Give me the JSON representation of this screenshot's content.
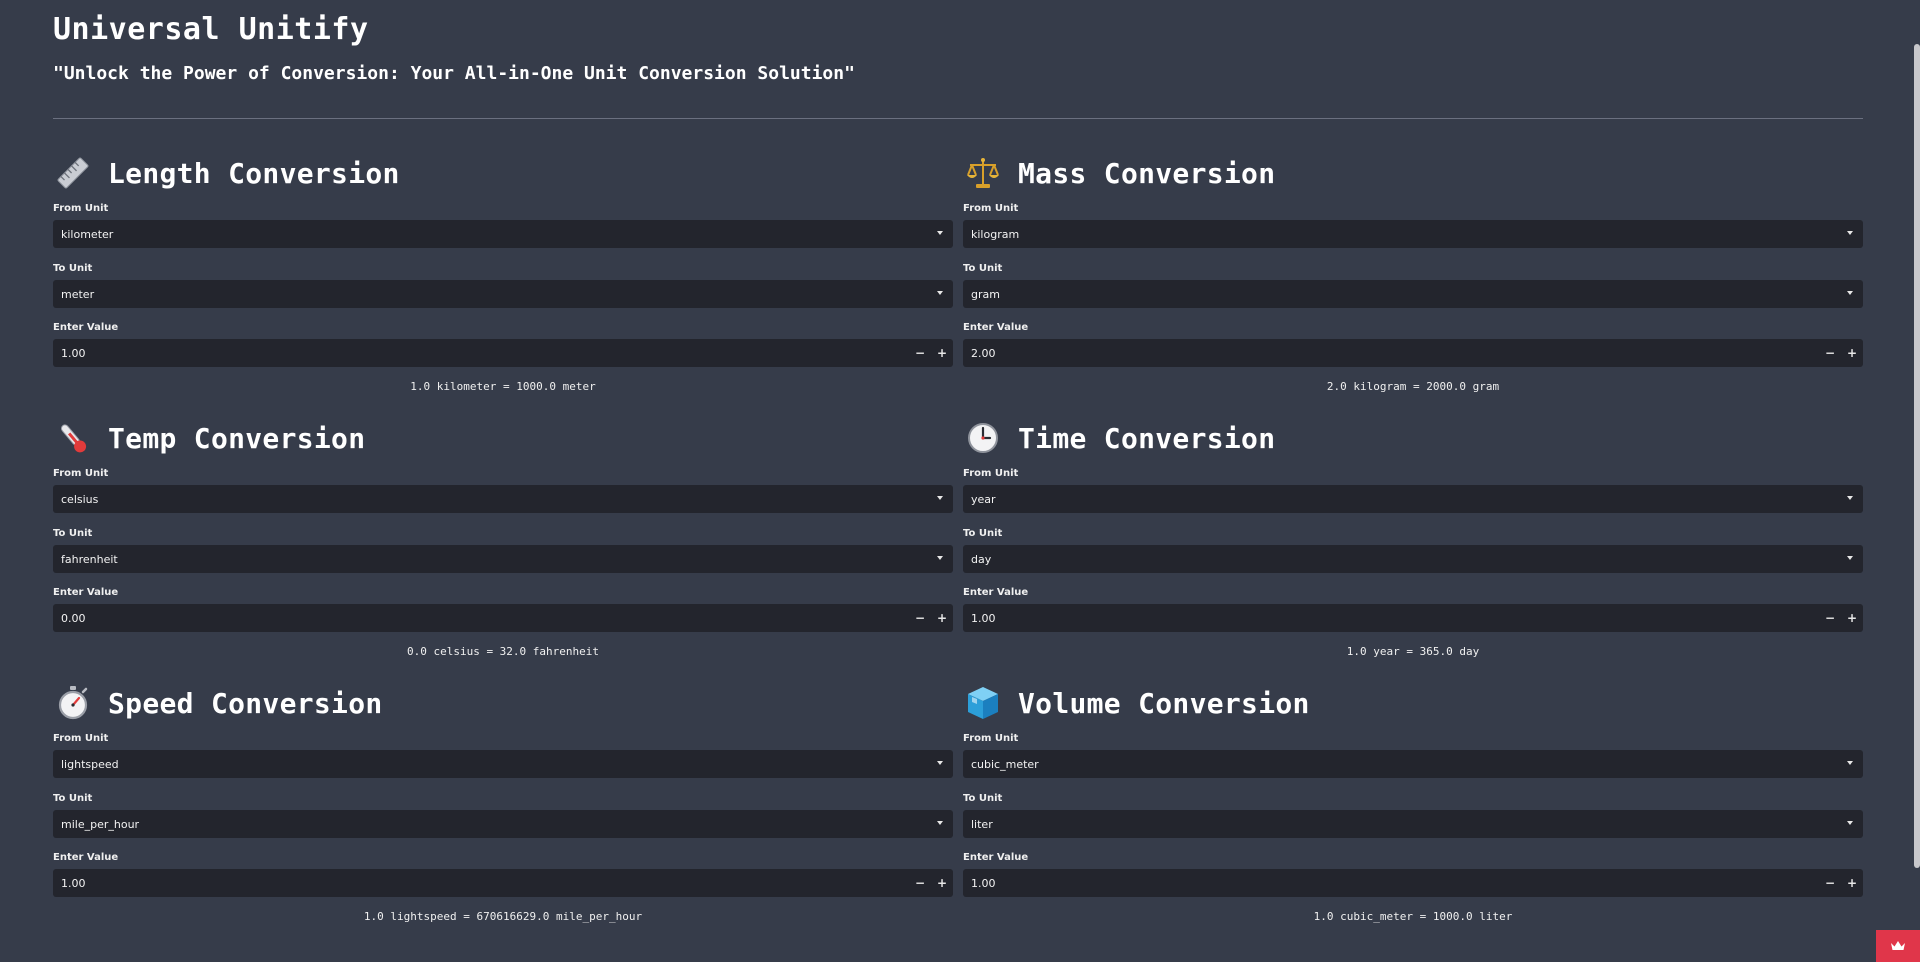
{
  "app": {
    "title": "Universal Unitify",
    "subtitle": "\"Unlock the Power of Conversion: Your All-in-One Unit Conversion Solution\""
  },
  "labels": {
    "from_unit": "From Unit",
    "to_unit": "To Unit",
    "enter_value": "Enter Value",
    "minus": "−",
    "plus": "+"
  },
  "sections": [
    {
      "icon": "ruler-icon",
      "title": "Length Conversion",
      "from_unit": "kilometer",
      "to_unit": "meter",
      "value": "1.00",
      "result": "1.0 kilometer = 1000.0 meter"
    },
    {
      "icon": "balance-scale-icon",
      "title": "Mass Conversion",
      "from_unit": "kilogram",
      "to_unit": "gram",
      "value": "2.00",
      "result": "2.0 kilogram = 2000.0 gram"
    },
    {
      "icon": "thermometer-icon",
      "title": "Temp Conversion",
      "from_unit": "celsius",
      "to_unit": "fahrenheit",
      "value": "0.00",
      "result": "0.0 celsius = 32.0 fahrenheit"
    },
    {
      "icon": "clock-icon",
      "title": "Time Conversion",
      "from_unit": "year",
      "to_unit": "day",
      "value": "1.00",
      "result": "1.0 year = 365.0 day"
    },
    {
      "icon": "stopwatch-icon",
      "title": "Speed Conversion",
      "from_unit": "lightspeed",
      "to_unit": "mile_per_hour",
      "value": "1.00",
      "result": "1.0 lightspeed = 670616629.0 mile_per_hour"
    },
    {
      "icon": "ice-cube-icon",
      "title": "Volume Conversion",
      "from_unit": "cubic_meter",
      "to_unit": "liter",
      "value": "1.00",
      "result": "1.0 cubic_meter = 1000.0 liter"
    }
  ],
  "colors": {
    "background": "#363c4a",
    "input_background": "#23252d",
    "accent": "#e0364a"
  }
}
